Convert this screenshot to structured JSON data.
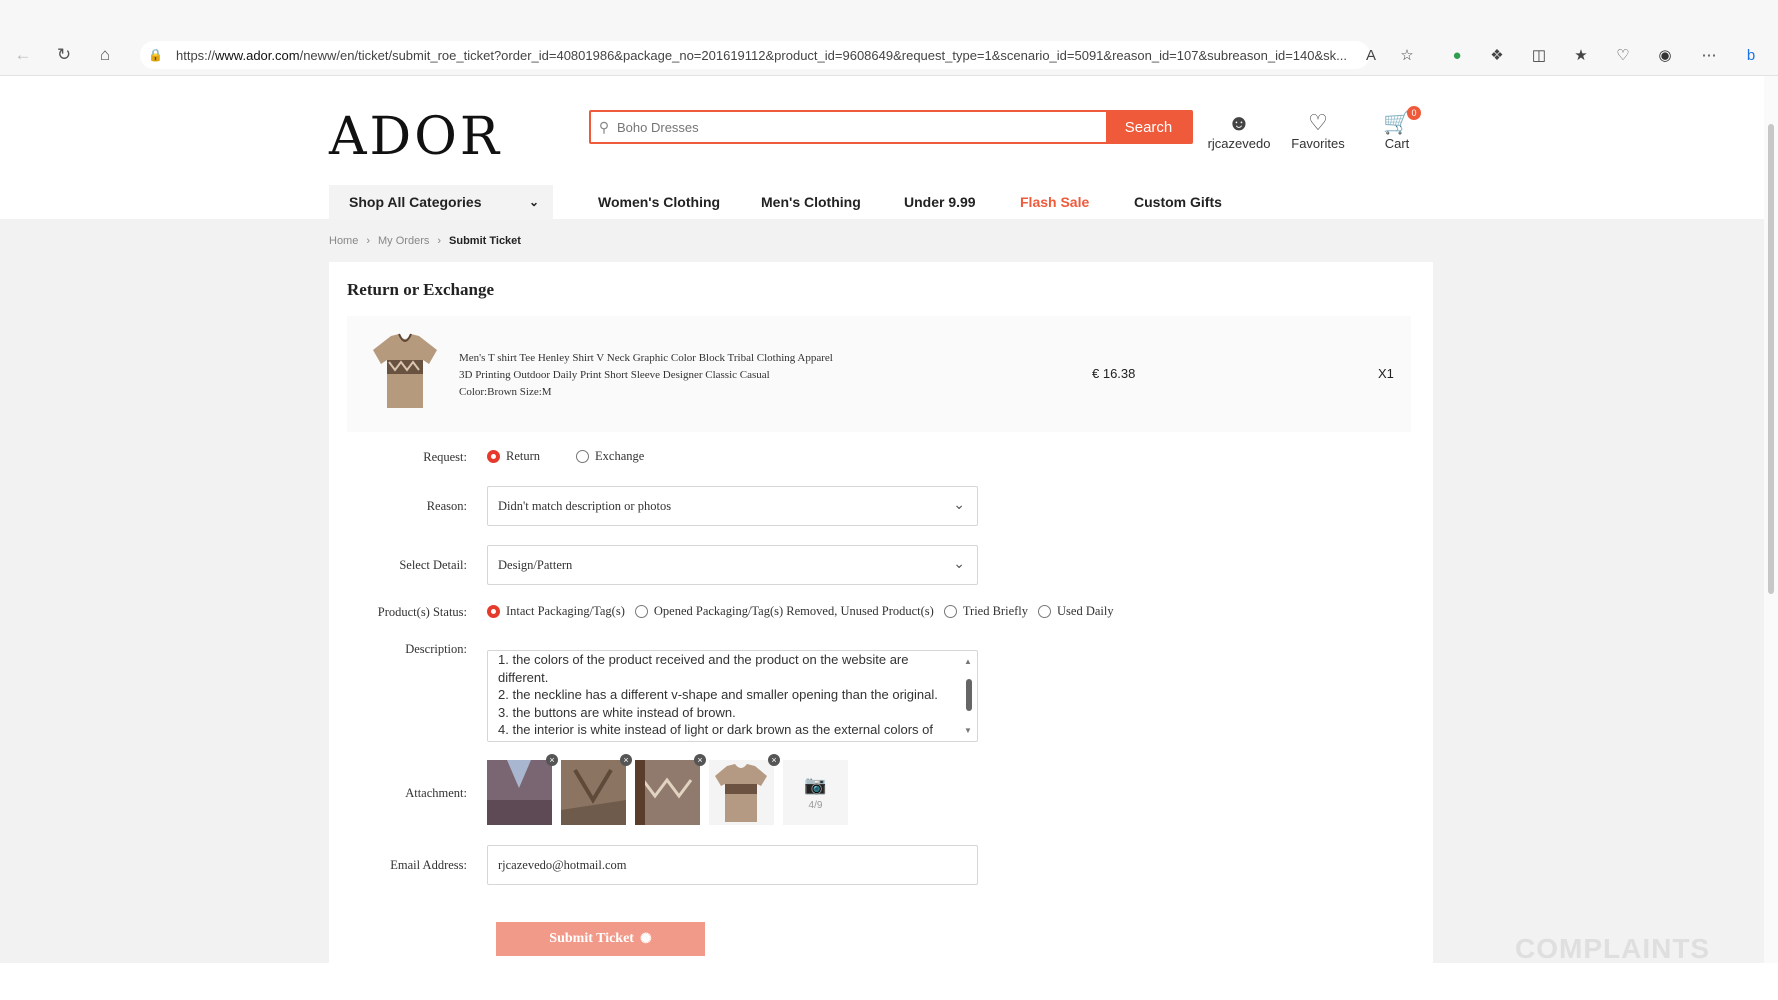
{
  "browser": {
    "url_prefix": "https://",
    "url_domain": "www.ador.com",
    "url_path": "/neww/en/ticket/submit_roe_ticket?order_id=40801986&package_no=201619112&product_id=9608649&request_type=1&scenario_id=5091&reason_id=107&subreason_id=140&sk..."
  },
  "header": {
    "logo": "ADOR",
    "search_placeholder": "Boho Dresses",
    "search_button": "Search",
    "account_label": "rjcazevedo",
    "favorites_label": "Favorites",
    "cart_label": "Cart",
    "cart_count": "0"
  },
  "nav": {
    "categories": "Shop All Categories",
    "links": [
      "Women's Clothing",
      "Men's Clothing",
      "Under 9.99",
      "Flash Sale",
      "Custom Gifts"
    ]
  },
  "breadcrumb": [
    "Home",
    "My Orders",
    "Submit Ticket"
  ],
  "form": {
    "title": "Return or Exchange",
    "product": {
      "name_line1": "Men's T shirt Tee Henley Shirt V Neck Graphic Color Block Tribal Clothing Apparel",
      "name_line2": "3D Printing Outdoor Daily Print Short Sleeve Designer Classic Casual",
      "variant": "Color:Brown Size:M",
      "price": "€ 16.38",
      "qty": "X1"
    },
    "request_label": "Request:",
    "request_options": [
      "Return",
      "Exchange"
    ],
    "request_selected": "Return",
    "reason_label": "Reason:",
    "reason_value": "Didn't match description or photos",
    "detail_label": "Select Detail:",
    "detail_value": "Design/Pattern",
    "status_label": "Product(s) Status:",
    "status_options": [
      "Intact Packaging/Tag(s)",
      "Opened Packaging/Tag(s) Removed, Unused Product(s)",
      "Tried Briefly",
      "Used Daily"
    ],
    "status_selected": "Intact Packaging/Tag(s)",
    "description_label": "Description:",
    "description_lines": [
      "1. the colors of the product received and the product on the website are",
      "different.",
      "2. the neckline has a different v-shape and smaller opening than the original.",
      "3. the buttons are white instead of brown.",
      "4. the interior is white instead of light or dark brown as the external colors of the"
    ],
    "attachment_label": "Attachment:",
    "attachment_count": "4/9",
    "email_label": "Email Address:",
    "email_value": "rjcazevedo@hotmail.com",
    "submit_label": "Submit Ticket"
  },
  "watermark": "COMPLAINTS",
  "colors": {
    "accent": "#ef5a3b",
    "radio_on": "#e53a2c",
    "submit_disabled": "#f29a89"
  }
}
